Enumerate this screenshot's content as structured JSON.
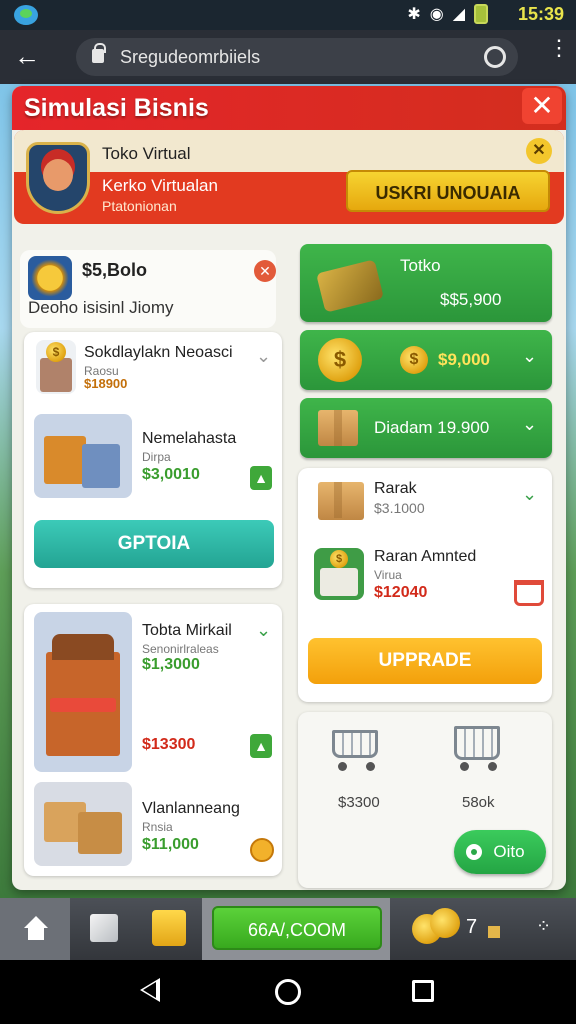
{
  "status_bar": {
    "time": "15:39"
  },
  "browser": {
    "url": "Sregudeomrbiiels"
  },
  "modal": {
    "title": "Simulasi Bisnis",
    "close_symbol": "✕"
  },
  "banner": {
    "shop_name": "Toko Virtual",
    "subtitle": "Kerko Virtualan",
    "caption": "Ptatonionan",
    "button": "USKRI UNOUAIA"
  },
  "balance": {
    "amount": "$5,Bolo",
    "description": "Deoho isisinl Jiomy"
  },
  "left_card_1": {
    "item1": {
      "title": "Sokdlaylakn Neoasci",
      "sub": "Raosu",
      "value": "$18900"
    },
    "item2": {
      "title": "Nemelahasta",
      "sub": "Dirpa",
      "value": "$3,0010"
    },
    "button": "GPTOIA"
  },
  "left_card_2": {
    "item1": {
      "title": "Tobta Mirkail",
      "sub": "Senonirlraleas",
      "value1": "$1,3000",
      "value2": "$13300"
    },
    "item2": {
      "title": "Vlanlanneang",
      "sub": "Rnsia",
      "value": "$11,000"
    }
  },
  "right_buttons": {
    "g1": {
      "title": "Totko",
      "value": "$$5,900"
    },
    "g2": {
      "value": "$9,000"
    },
    "g3": {
      "value": "Diadam 19.900"
    }
  },
  "right_card_1": {
    "item1": {
      "title": "Rarak",
      "value": "$3.1000"
    },
    "item2": {
      "title": "Raran Amnted",
      "sub": "Virua",
      "value": "$12040"
    },
    "button": "UPPRADE"
  },
  "right_card_2": {
    "cart1_price": "$3300",
    "cart2_price": "58ok",
    "fab_label": "Oito"
  },
  "game_nav": {
    "center_label": "66A/,COOM",
    "seven": "7"
  }
}
